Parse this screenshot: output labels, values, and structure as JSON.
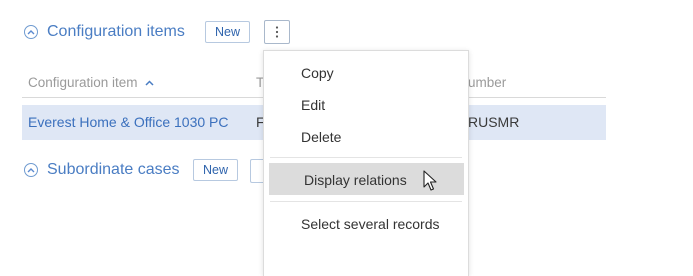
{
  "configuration_items": {
    "title": "Configuration items",
    "new_label": "New",
    "more_icon": "vertical-ellipsis-icon",
    "collapse_icon": "chevron-up-circle-icon"
  },
  "table": {
    "columns": [
      {
        "label": "Configuration item",
        "sort": "ascending"
      },
      {
        "label": "T"
      },
      {
        "label": "umber"
      }
    ],
    "rows": [
      {
        "configuration_item": "Everest Home & Office 1030 PC",
        "type": "F",
        "number": "RUSMR"
      }
    ]
  },
  "subordinate_cases": {
    "title": "Subordinate cases",
    "new_label": "New",
    "collapse_icon": "chevron-up-circle-icon"
  },
  "context_menu": {
    "items": [
      "Copy",
      "Edit",
      "Delete",
      "Display relations",
      "Select several records"
    ],
    "hovered": "Display relations"
  },
  "colors": {
    "accent": "#4a7dc3",
    "row_selected": "#dfe7f5",
    "menu_hover": "#dcdcdc"
  }
}
